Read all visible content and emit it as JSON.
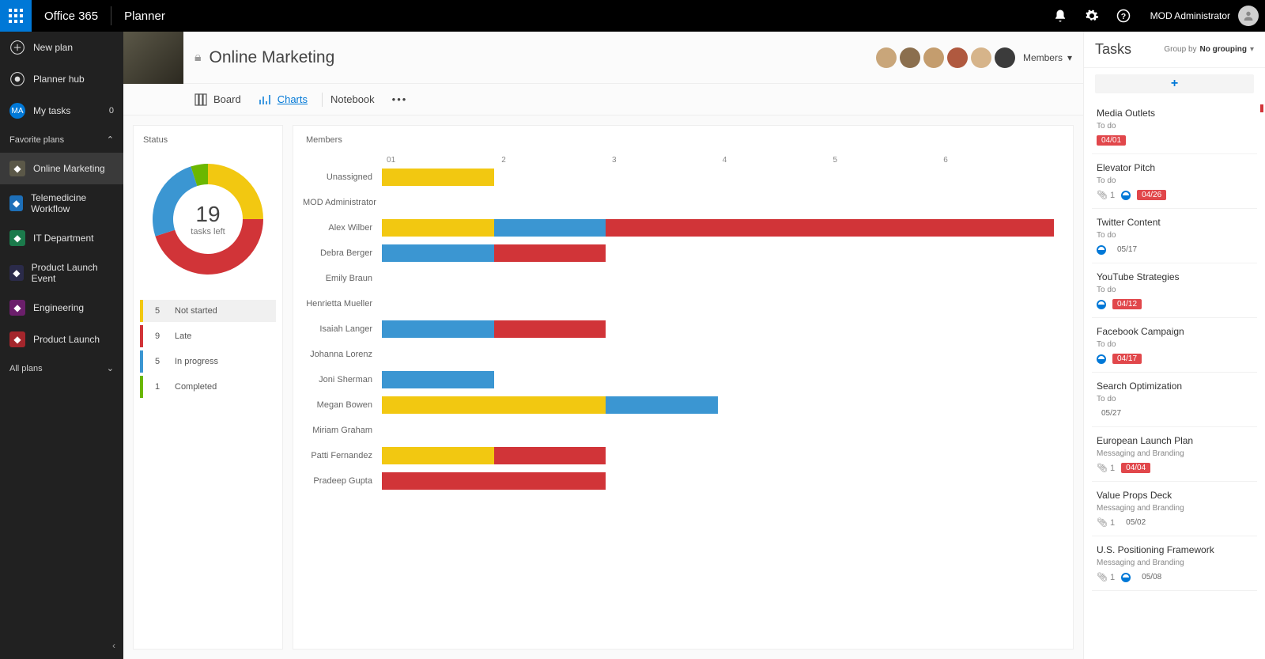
{
  "topbar": {
    "brand": "Office 365",
    "app": "Planner",
    "user": "MOD Administrator"
  },
  "leftnav": {
    "new_plan": "New plan",
    "planner_hub": "Planner hub",
    "my_tasks": "My tasks",
    "my_tasks_count": "0",
    "ma_initials": "MA",
    "favorites_header": "Favorite plans",
    "all_plans_header": "All plans",
    "favorites": [
      {
        "label": "Online Marketing",
        "bg": "#5b5848",
        "active": true
      },
      {
        "label": "Telemedicine Workflow",
        "bg": "#1d6fb8"
      },
      {
        "label": "IT Department",
        "bg": "#1b7a4b"
      },
      {
        "label": "Product Launch Event",
        "bg": "#2b2b4a"
      },
      {
        "label": "Engineering",
        "bg": "#6b1f6b"
      },
      {
        "label": "Product Launch",
        "bg": "#a4262c"
      }
    ]
  },
  "plan": {
    "title": "Online Marketing",
    "members_label": "Members",
    "avatar_colors": [
      "#c9a67a",
      "#8b6f4e",
      "#c49d6e",
      "#b0593f",
      "#d6b48a",
      "#3b3b3b"
    ],
    "tabs": {
      "board": "Board",
      "charts": "Charts",
      "notebook": "Notebook"
    }
  },
  "status_card": {
    "title": "Status",
    "total": "19",
    "total_label": "tasks left",
    "legend": [
      {
        "count": "5",
        "label": "Not started",
        "color": "#f2c811",
        "sel": true
      },
      {
        "count": "9",
        "label": "Late",
        "color": "#d13438"
      },
      {
        "count": "5",
        "label": "In progress",
        "color": "#3b96d2"
      },
      {
        "count": "1",
        "label": "Completed",
        "color": "#6bb700"
      }
    ]
  },
  "members_card": {
    "title": "Members"
  },
  "chart_data": {
    "type": "bar",
    "title": "Members",
    "xlabel": "",
    "ylabel": "",
    "xlim": [
      0,
      6
    ],
    "ticks": [
      0,
      1,
      2,
      3,
      4,
      5,
      6
    ],
    "categories": [
      "Unassigned",
      "MOD Administrator",
      "Alex Wilber",
      "Debra Berger",
      "Emily Braun",
      "Henrietta Mueller",
      "Isaiah Langer",
      "Johanna Lorenz",
      "Joni Sherman",
      "Megan Bowen",
      "Miriam Graham",
      "Patti Fernandez",
      "Pradeep Gupta"
    ],
    "series": [
      {
        "name": "Not started",
        "color": "#f2c811",
        "values": [
          1,
          0,
          1,
          0,
          0,
          0,
          0,
          0,
          0,
          2,
          0,
          1,
          0
        ]
      },
      {
        "name": "In progress",
        "color": "#3b96d2",
        "values": [
          0,
          0,
          1,
          1,
          0,
          0,
          1,
          0,
          1,
          1,
          0,
          0,
          0
        ]
      },
      {
        "name": "Late",
        "color": "#d13438",
        "values": [
          0,
          0,
          4,
          1,
          0,
          0,
          1,
          0,
          0,
          0,
          0,
          1,
          2
        ]
      }
    ],
    "donut": {
      "type": "pie",
      "title": "Status",
      "slices": [
        {
          "label": "Not started",
          "value": 5,
          "color": "#f2c811"
        },
        {
          "label": "Late",
          "value": 9,
          "color": "#d13438"
        },
        {
          "label": "In progress",
          "value": 5,
          "color": "#3b96d2"
        },
        {
          "label": "Completed",
          "value": 1,
          "color": "#6bb700"
        }
      ]
    }
  },
  "rightpanel": {
    "title": "Tasks",
    "group_by_label": "Group by",
    "group_by_value": "No grouping",
    "tasks": [
      {
        "title": "Media Outlets",
        "sub": "To do",
        "attach": false,
        "progress": false,
        "date": "04/01",
        "late": true
      },
      {
        "title": "Elevator Pitch",
        "sub": "To do",
        "attach": true,
        "attach_count": "1",
        "progress": true,
        "date": "04/26",
        "late": true
      },
      {
        "title": "Twitter Content",
        "sub": "To do",
        "attach": false,
        "progress": true,
        "date": "05/17",
        "late": false
      },
      {
        "title": "YouTube Strategies",
        "sub": "To do",
        "attach": false,
        "progress": true,
        "date": "04/12",
        "late": true
      },
      {
        "title": "Facebook Campaign",
        "sub": "To do",
        "attach": false,
        "progress": true,
        "date": "04/17",
        "late": true
      },
      {
        "title": "Search Optimization",
        "sub": "To do",
        "attach": false,
        "progress": false,
        "date": "05/27",
        "late": false
      },
      {
        "title": "European Launch Plan",
        "sub": "Messaging and Branding",
        "attach": true,
        "attach_count": "1",
        "progress": false,
        "date": "04/04",
        "late": true
      },
      {
        "title": "Value Props Deck",
        "sub": "Messaging and Branding",
        "attach": true,
        "attach_count": "1",
        "progress": false,
        "date": "05/02",
        "late": false
      },
      {
        "title": "U.S. Positioning Framework",
        "sub": "Messaging and Branding",
        "attach": true,
        "attach_count": "1",
        "progress": true,
        "date": "05/08",
        "late": false
      }
    ]
  }
}
